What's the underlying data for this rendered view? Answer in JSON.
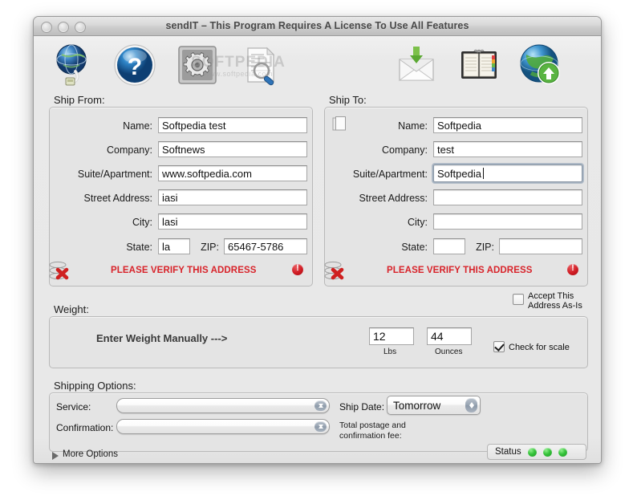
{
  "window": {
    "title": "sendIT – This Program Requires A License To Use All Features",
    "traffic_lights": [
      "close",
      "minimize",
      "zoom"
    ]
  },
  "watermark": {
    "line1": "SOFTPEDIA",
    "line2": "www.softpedia.com"
  },
  "toolbar": {
    "items": [
      {
        "name": "network-globe-icon",
        "label": "Network"
      },
      {
        "name": "help-question-icon",
        "label": "Help"
      },
      {
        "name": "preferences-gear-icon",
        "label": "Preferences"
      },
      {
        "name": "document-search-icon",
        "label": "Look Up"
      },
      {
        "name": "mail-receive-icon",
        "label": "Receive"
      },
      {
        "name": "address-book-icon",
        "label": "Address Book"
      },
      {
        "name": "globe-upload-icon",
        "label": "Send"
      }
    ]
  },
  "ship_from": {
    "group_label": "Ship From:",
    "fields": [
      {
        "label": "Name:",
        "value": "Softpedia test"
      },
      {
        "label": "Company:",
        "value": "Softnews"
      },
      {
        "label": "Suite/Apartment:",
        "value": "www.softpedia.com"
      },
      {
        "label": "Street Address:",
        "value": "iasi"
      },
      {
        "label": "City:",
        "value": "lasi"
      }
    ],
    "state_label": "State:",
    "state_value": "la",
    "zip_label": "ZIP:",
    "zip_value": "65467-5786",
    "verify_text": "PLEASE VERIFY THIS ADDRESS"
  },
  "ship_to": {
    "group_label": "Ship To:",
    "fields": [
      {
        "label": "Name:",
        "value": "Softpedia"
      },
      {
        "label": "Company:",
        "value": "test"
      },
      {
        "label": "Suite/Apartment:",
        "value": "Softpedia "
      },
      {
        "label": "Street Address:",
        "value": ""
      },
      {
        "label": "City:",
        "value": ""
      }
    ],
    "state_label": "State:",
    "state_value": "",
    "zip_label": "ZIP:",
    "zip_value": "",
    "verify_text": "PLEASE VERIFY THIS ADDRESS",
    "accept_as_is_line1": "Accept This",
    "accept_as_is_line2": "Address As-Is",
    "accept_as_is_checked": false
  },
  "weight": {
    "group_label": "Weight:",
    "manual_label": "Enter Weight Manually --->",
    "lbs_value": "12",
    "lbs_unit": "Lbs",
    "ounces_value": "44",
    "ounces_unit": "Ounces",
    "check_scale_label": "Check for scale",
    "check_scale_checked": true
  },
  "shipping_options": {
    "group_label": "Shipping Options:",
    "service_label": "Service:",
    "service_value": "",
    "confirmation_label": "Confirmation:",
    "confirmation_value": "",
    "ship_date_label": "Ship Date:",
    "ship_date_value": "Tomorrow",
    "fee_line1": "Total postage and",
    "fee_line2": "confirmation fee:"
  },
  "footer": {
    "more_options_label": "More Options",
    "status_label": "Status",
    "status_leds": [
      "green",
      "green",
      "green"
    ]
  },
  "colors": {
    "error_red": "#d8232a",
    "led_green": "#35c23a",
    "panel_gray": "#e4e4e4",
    "window_gray": "#e8e8e8"
  }
}
